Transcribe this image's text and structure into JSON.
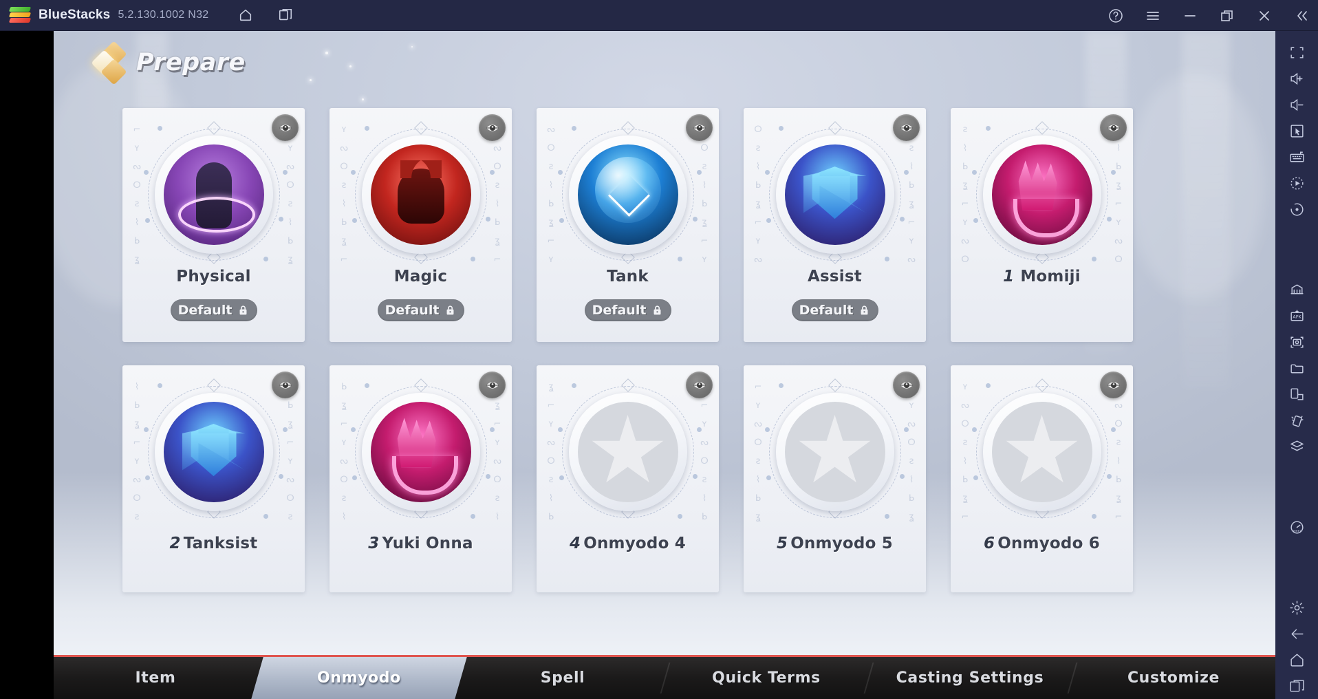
{
  "titlebar": {
    "app_name": "BlueStacks",
    "version": "5.2.130.1002 N32",
    "nav_icons": [
      {
        "name": "home-icon",
        "label": "Home"
      },
      {
        "name": "instance-manager-icon",
        "label": "Instance Manager"
      }
    ],
    "window_icons": [
      {
        "name": "help-icon",
        "label": "Help"
      },
      {
        "name": "menu-icon",
        "label": "Menu"
      },
      {
        "name": "minimize-icon",
        "label": "Minimize"
      },
      {
        "name": "restore-icon",
        "label": "Restore"
      },
      {
        "name": "close-icon",
        "label": "Close"
      },
      {
        "name": "collapse-sidebar-icon",
        "label": "Collapse"
      }
    ]
  },
  "sidebar": {
    "items": [
      {
        "name": "fullscreen-icon",
        "label": "Full screen"
      },
      {
        "name": "volume-up-icon",
        "label": "Volume up"
      },
      {
        "name": "volume-down-icon",
        "label": "Volume down"
      },
      {
        "name": "cursor-icon",
        "label": "Game controls"
      },
      {
        "name": "keyboard-icon",
        "label": "Keyboard controls"
      },
      {
        "name": "macro-recorder-icon",
        "label": "Macro recorder"
      },
      {
        "name": "rotate-icon",
        "label": "Rotate"
      },
      {
        "name": "game-guide-icon",
        "label": "Game guide"
      },
      {
        "name": "install-apk-icon",
        "label": "Install APK"
      },
      {
        "name": "screenshot-icon",
        "label": "Screenshot"
      },
      {
        "name": "media-manager-icon",
        "label": "Media manager"
      },
      {
        "name": "multi-instance-icon",
        "label": "Multi-instance"
      },
      {
        "name": "shake-icon",
        "label": "Shake"
      },
      {
        "name": "layers-icon",
        "label": "Layers"
      },
      {
        "name": "performance-icon",
        "label": "Performance"
      },
      {
        "name": "settings-gear-icon",
        "label": "Settings"
      },
      {
        "name": "back-arrow-icon",
        "label": "Back"
      },
      {
        "name": "android-home-icon",
        "label": "Home"
      },
      {
        "name": "recents-icon",
        "label": "Recent apps"
      }
    ]
  },
  "game": {
    "header": {
      "title": "Prepare",
      "icon": "diamond-cluster-icon"
    },
    "cards": [
      {
        "index": "",
        "name": "Physical",
        "badge": "Default",
        "locked": true,
        "art": "art-physical",
        "empty": false,
        "row": 1
      },
      {
        "index": "",
        "name": "Magic",
        "badge": "Default",
        "locked": true,
        "art": "art-magic",
        "empty": false,
        "row": 1
      },
      {
        "index": "",
        "name": "Tank",
        "badge": "Default",
        "locked": true,
        "art": "art-tank",
        "empty": false,
        "row": 1
      },
      {
        "index": "",
        "name": "Assist",
        "badge": "Default",
        "locked": true,
        "art": "art-assist",
        "empty": false,
        "row": 1
      },
      {
        "index": "1",
        "name": "Momiji",
        "badge": "",
        "locked": false,
        "art": "art-momiji",
        "empty": false,
        "row": 1
      },
      {
        "index": "2",
        "name": "Tanksist",
        "badge": "",
        "locked": false,
        "art": "art-assist",
        "empty": false,
        "row": 2
      },
      {
        "index": "3",
        "name": "Yuki Onna",
        "badge": "",
        "locked": false,
        "art": "art-momiji",
        "empty": false,
        "row": 2
      },
      {
        "index": "4",
        "name": "Onmyodo 4",
        "badge": "",
        "locked": false,
        "art": "art-empty",
        "empty": true,
        "row": 2
      },
      {
        "index": "5",
        "name": "Onmyodo 5",
        "badge": "",
        "locked": false,
        "art": "art-empty",
        "empty": true,
        "row": 2
      },
      {
        "index": "6",
        "name": "Onmyodo 6",
        "badge": "",
        "locked": false,
        "art": "art-empty",
        "empty": true,
        "row": 2
      }
    ],
    "card_action_icon": "eye-icon",
    "tabs": [
      {
        "label": "Item",
        "active": false
      },
      {
        "label": "Onmyodo",
        "active": true
      },
      {
        "label": "Spell",
        "active": false
      },
      {
        "label": "Quick Terms",
        "active": false
      },
      {
        "label": "Casting Settings",
        "active": false
      },
      {
        "label": "Customize",
        "active": false
      }
    ]
  },
  "colors": {
    "titlebar_bg": "#242845",
    "sidebar_bg": "#272b4a",
    "accent_red": "#e0554f",
    "card_bg": "#f2f4f8",
    "badge_gray": "#7b7f87",
    "tab_active_bg": "#aeb8c9"
  }
}
